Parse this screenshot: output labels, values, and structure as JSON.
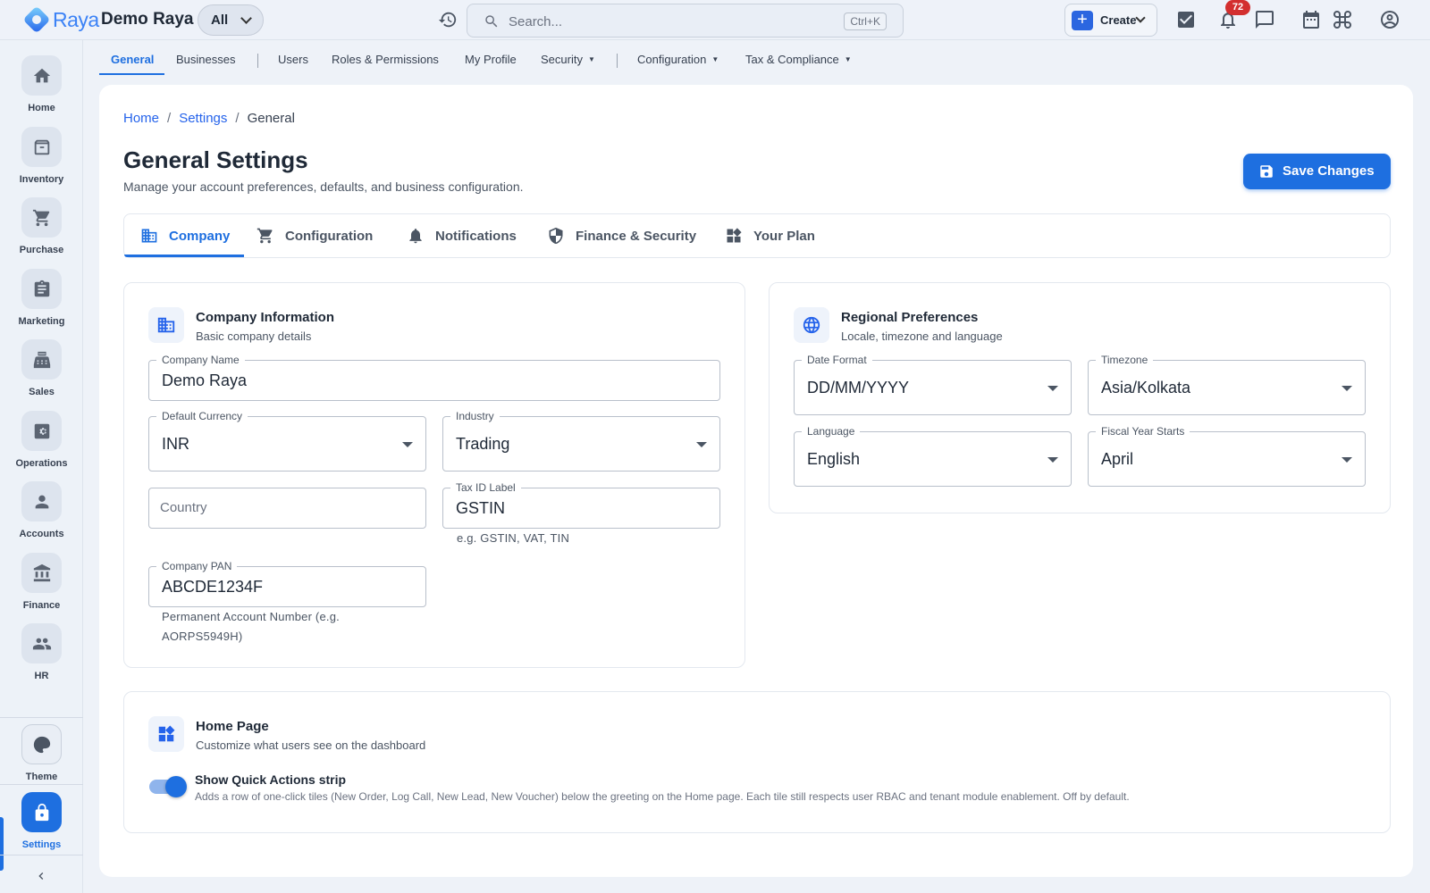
{
  "app": {
    "brand": "Raya",
    "org_name": "Demo Raya",
    "scope": "All"
  },
  "topbar": {
    "search_placeholder": "Search...",
    "search_shortcut": "Ctrl+K",
    "create_label": "Create",
    "notification_count": "72",
    "icons": [
      "history-icon",
      "search-icon",
      "tasks-icon",
      "bell-icon",
      "chat-icon",
      "calendar-icon",
      "command-icon",
      "account-icon"
    ]
  },
  "sidebar": {
    "items": [
      {
        "label": "Home",
        "icon": "home-icon"
      },
      {
        "label": "Inventory",
        "icon": "archive-icon"
      },
      {
        "label": "Purchase",
        "icon": "cart-icon"
      },
      {
        "label": "Marketing",
        "icon": "clipboard-icon"
      },
      {
        "label": "Sales",
        "icon": "register-icon"
      },
      {
        "label": "Operations",
        "icon": "cog-box-icon"
      },
      {
        "label": "Accounts",
        "icon": "person-icon"
      },
      {
        "label": "Finance",
        "icon": "bank-icon"
      },
      {
        "label": "HR",
        "icon": "people-icon"
      }
    ],
    "theme_label": "Theme",
    "settings_label": "Settings"
  },
  "subnav": {
    "items": [
      "General",
      "Businesses",
      "Users",
      "Roles & Permissions",
      "My Profile",
      "Security",
      "Configuration",
      "Tax & Compliance"
    ]
  },
  "breadcrumb": {
    "home": "Home",
    "settings": "Settings",
    "current": "General"
  },
  "page": {
    "title": "General Settings",
    "subtitle": "Manage your account preferences, defaults, and business configuration.",
    "save_label": "Save Changes"
  },
  "tabs": [
    "Company",
    "Configuration",
    "Notifications",
    "Finance & Security",
    "Your Plan"
  ],
  "company_card": {
    "title": "Company Information",
    "subtitle": "Basic company details",
    "company_name_label": "Company Name",
    "company_name": "Demo Raya",
    "currency_label": "Default Currency",
    "currency": "INR",
    "industry_label": "Industry",
    "industry": "Trading",
    "country_placeholder": "Country",
    "tax_label": "Tax ID Label",
    "tax_value": "GSTIN",
    "tax_helper": "e.g. GSTIN, VAT, TIN",
    "pan_label": "Company PAN",
    "pan_value": "ABCDE1234F",
    "pan_helper_1": "Permanent Account Number (e.g.",
    "pan_helper_2": "AORPS5949H)"
  },
  "regional_card": {
    "title": "Regional Preferences",
    "subtitle": "Locale, timezone and language",
    "date_format_label": "Date Format",
    "date_format": "DD/MM/YYYY",
    "timezone_label": "Timezone",
    "timezone": "Asia/Kolkata",
    "language_label": "Language",
    "language": "English",
    "fiscal_label": "Fiscal Year Starts",
    "fiscal": "April"
  },
  "home_card": {
    "title": "Home Page",
    "subtitle": "Customize what users see on the dashboard",
    "toggle_title": "Show Quick Actions strip",
    "toggle_desc": "Adds a row of one-click tiles (New Order, Log Call, New Lead, New Voucher) below the greeting on the Home page. Each tile still respects user RBAC and tenant module enablement. Off by default.",
    "toggle_on": true
  },
  "colors": {
    "accent": "#1e6fe0",
    "badge": "#d32f2f"
  }
}
